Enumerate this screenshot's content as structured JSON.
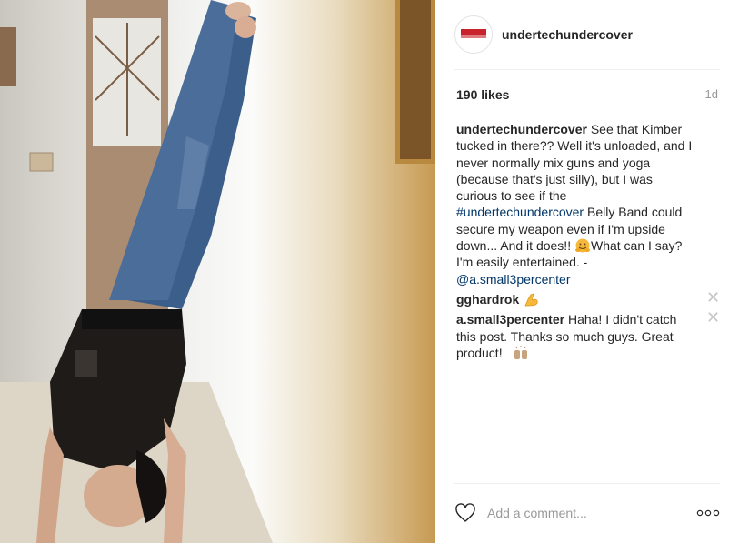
{
  "header": {
    "username": "undertechundercover",
    "avatar_icon": "brand-logo-icon"
  },
  "post": {
    "likes": "190 likes",
    "age": "1d"
  },
  "caption": {
    "user": "undertechundercover",
    "text1": "See that Kimber tucked in there?? Well it's unloaded, and I never normally mix guns and yoga (because that's just silly), but I was curious to see if the ",
    "hashtag": "#undertechundercover",
    "text2": " Belly Band could secure my weapon even if I'm upside down... And it does!! ",
    "text3": "What can I say? I'm easily entertained. - ",
    "mention": "@a.small3percenter"
  },
  "comments": [
    {
      "user": "gghardrok",
      "text": " ",
      "emoji": "flexed-biceps-emoji"
    },
    {
      "user": "a.small3percenter",
      "text": " Haha! I didn't catch this post. Thanks so much guys. Great product! ",
      "emoji": "praising-hands-emoji"
    }
  ],
  "footer": {
    "add_comment_placeholder": "Add a comment..."
  },
  "colors": {
    "link": "#003569",
    "muted": "#999999",
    "brand_red": "#c8232c"
  }
}
